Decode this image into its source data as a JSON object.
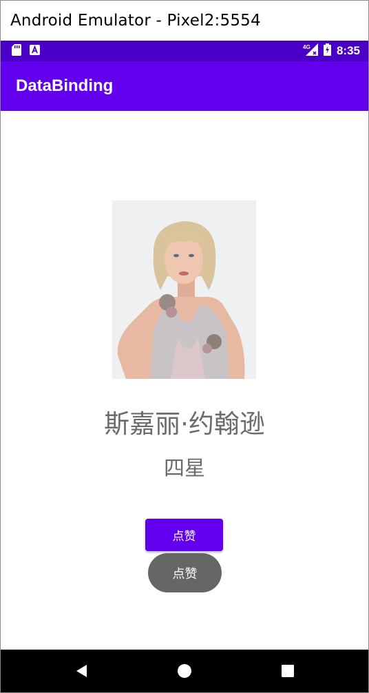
{
  "window": {
    "title": "Android Emulator - Pixel2:5554"
  },
  "status_bar": {
    "time": "8:35",
    "network": "4G",
    "icons": [
      "sd-card-icon",
      "accessibility-a-icon",
      "signal-4g-icon",
      "battery-charging-icon"
    ],
    "color": "#4b00c8"
  },
  "app_bar": {
    "title": "DataBinding",
    "color": "#6200ee"
  },
  "main": {
    "photo_alt": "person-photo",
    "name": "斯嘉丽·约翰逊",
    "rating": "四星",
    "like_button_label": "点赞",
    "toast_text": "点赞"
  },
  "nav_bar": {
    "buttons": [
      "back-icon",
      "home-icon",
      "recents-icon"
    ]
  }
}
